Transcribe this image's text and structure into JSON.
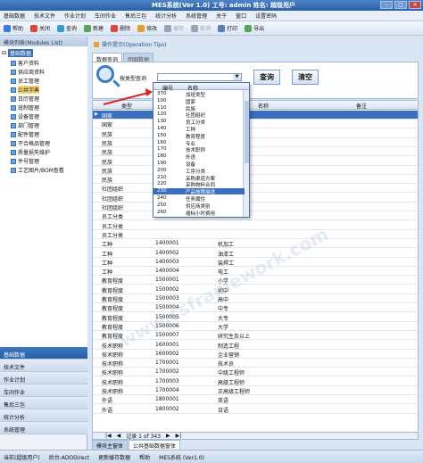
{
  "window": {
    "title": "MES系统(Ver 1.0) 工号: admin 姓名: 超级用户"
  },
  "menu": [
    "基础数据",
    "技术文件",
    "作业计划",
    "车间作业",
    "售后三包",
    "统计分析",
    "系统管理",
    "关于",
    "窗口",
    "设置密码"
  ],
  "toolbar": [
    {
      "label": "帮助",
      "color": "#3a7bd5",
      "enabled": true
    },
    {
      "label": "关闭",
      "color": "#d64a3a",
      "enabled": true
    },
    {
      "label": "查询",
      "color": "#3a9bd5",
      "enabled": true
    },
    {
      "label": "新建",
      "color": "#5aa35a",
      "enabled": true
    },
    {
      "label": "删除",
      "color": "#d64a3a",
      "enabled": true
    },
    {
      "label": "修改",
      "color": "#e0a030",
      "enabled": true
    },
    {
      "label": "保存",
      "color": "#9aa5b4",
      "enabled": false
    },
    {
      "label": "取消",
      "color": "#9aa5b4",
      "enabled": false
    },
    {
      "label": "打印",
      "color": "#5a7fb3",
      "enabled": true
    },
    {
      "label": "导出",
      "color": "#5aa35a",
      "enabled": true
    }
  ],
  "sidebar": {
    "header": "模块列表(Modules List)",
    "root": "基础数据",
    "items": [
      "客户资料",
      "供应商资料",
      "员工管理",
      "公共字典",
      "日历管理",
      "班制管理",
      "设备管理",
      "部门管理",
      "配件管理",
      "不合格品管理",
      "质量损失维护",
      "件号管理",
      "工艺图片/BOM查看"
    ],
    "modules": [
      "基础数据",
      "技术文件",
      "作业计划",
      "车间作业",
      "售后三包",
      "统计分析",
      "系统管理"
    ]
  },
  "content": {
    "breadcrumb": "操作提示(Operation Tips)",
    "tabs_top": [
      "数据查询",
      "明细数据"
    ],
    "query_label": "按类型查询",
    "query_btn": "查询",
    "clear_btn": "清空",
    "grid_headers": [
      "类型",
      "编码",
      "名称",
      "备注"
    ],
    "rows": [
      {
        "type": "国家",
        "code": "",
        "name": ""
      },
      {
        "type": "国家",
        "code": "",
        "name": ""
      },
      {
        "type": "民族",
        "code": "",
        "name": ""
      },
      {
        "type": "民族",
        "code": "",
        "name": ""
      },
      {
        "type": "民族",
        "code": "",
        "name": ""
      },
      {
        "type": "民族",
        "code": "",
        "name": ""
      },
      {
        "type": "民族",
        "code": "",
        "name": ""
      },
      {
        "type": "民族",
        "code": "",
        "name": ""
      },
      {
        "type": "社团组织",
        "code": "",
        "name": ""
      },
      {
        "type": "社团组织",
        "code": "",
        "name": ""
      },
      {
        "type": "社团组织",
        "code": "",
        "name": ""
      },
      {
        "type": "员工分类",
        "code": "",
        "name": ""
      },
      {
        "type": "员工分类",
        "code": "",
        "name": ""
      },
      {
        "type": "员工分类",
        "code": "",
        "name": ""
      },
      {
        "type": "工种",
        "code": "1400001",
        "name": "机加工"
      },
      {
        "type": "工种",
        "code": "1400002",
        "name": "油漆工"
      },
      {
        "type": "工种",
        "code": "1400003",
        "name": "装焊工"
      },
      {
        "type": "工种",
        "code": "1400004",
        "name": "电工"
      },
      {
        "type": "教育程度",
        "code": "1500001",
        "name": "小学"
      },
      {
        "type": "教育程度",
        "code": "1500002",
        "name": "初中"
      },
      {
        "type": "教育程度",
        "code": "1500003",
        "name": "高中"
      },
      {
        "type": "教育程度",
        "code": "1500004",
        "name": "中专"
      },
      {
        "type": "教育程度",
        "code": "1500005",
        "name": "大专"
      },
      {
        "type": "教育程度",
        "code": "1500006",
        "name": "大学"
      },
      {
        "type": "教育程度",
        "code": "1500007",
        "name": "研究生及以上"
      },
      {
        "type": "技术职称",
        "code": "1600001",
        "name": "制造工程"
      },
      {
        "type": "技术职称",
        "code": "1600002",
        "name": "企业营销"
      },
      {
        "type": "技术职称",
        "code": "1700001",
        "name": "技术员"
      },
      {
        "type": "技术职称",
        "code": "1700002",
        "name": "中级工程师"
      },
      {
        "type": "技术职称",
        "code": "1700003",
        "name": "高级工程师"
      },
      {
        "type": "技术职称",
        "code": "1700004",
        "name": "正高级工程师"
      },
      {
        "type": "外语",
        "code": "1800001",
        "name": "英语"
      },
      {
        "type": "外语",
        "code": "1800002",
        "name": "日语"
      }
    ],
    "pager_text": "记录 1 of 343",
    "tabs_bottom": [
      "模块主窗体",
      "公共基础数据窗体"
    ]
  },
  "dropdown": {
    "headers": [
      "编号",
      "名称"
    ],
    "items": [
      {
        "code": "370",
        "name": "加班类型"
      },
      {
        "code": "100",
        "name": "国家"
      },
      {
        "code": "110",
        "name": "民族"
      },
      {
        "code": "120",
        "name": "社团组织"
      },
      {
        "code": "130",
        "name": "员工分类"
      },
      {
        "code": "140",
        "name": "工种"
      },
      {
        "code": "150",
        "name": "教育程度"
      },
      {
        "code": "160",
        "name": "专业"
      },
      {
        "code": "170",
        "name": "技术职称"
      },
      {
        "code": "180",
        "name": "外语"
      },
      {
        "code": "190",
        "name": "设备"
      },
      {
        "code": "200",
        "name": "工序分类"
      },
      {
        "code": "210",
        "name": "采购渠道方案"
      },
      {
        "code": "220",
        "name": "采购物料合同"
      },
      {
        "code": "230",
        "name": "产品故障描述"
      },
      {
        "code": "240",
        "name": "任务属性"
      },
      {
        "code": "250",
        "name": "供应商类别"
      },
      {
        "code": "260",
        "name": "缩标小时费用"
      }
    ],
    "selected_index": 14
  },
  "statusbar": [
    "当前(超级用户)",
    "后台:ADODirect",
    "更新缓存数据",
    "帮助",
    "MES系统 (Ver1.0)"
  ],
  "watermark": "www.csframework.com"
}
